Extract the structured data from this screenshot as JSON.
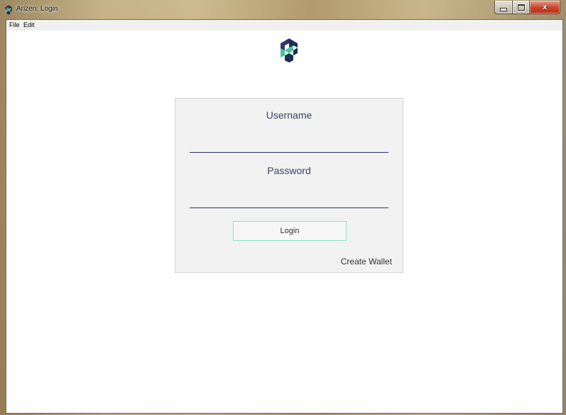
{
  "window": {
    "title": "Arizen: Login",
    "controls": {
      "minimize_icon": "minimize-icon",
      "maximize_icon": "maximize-icon",
      "close_label": "x"
    }
  },
  "menubar": {
    "items": [
      {
        "label": "File"
      },
      {
        "label": "Edit"
      }
    ]
  },
  "login": {
    "username_label": "Username",
    "username_value": "",
    "password_label": "Password",
    "password_value": "",
    "login_label": "Login",
    "create_wallet_label": "Create Wallet"
  },
  "colors": {
    "logo_dark": "#1f2d55",
    "logo_accent": "#47c4a0",
    "text": "#3b4461",
    "input_underline": "#2c3866",
    "button_border": "#8be3c5",
    "card_bg": "#f2f2f2"
  },
  "icons": {
    "app": "arizen-logo-icon",
    "logo": "arizen-logo-icon"
  }
}
